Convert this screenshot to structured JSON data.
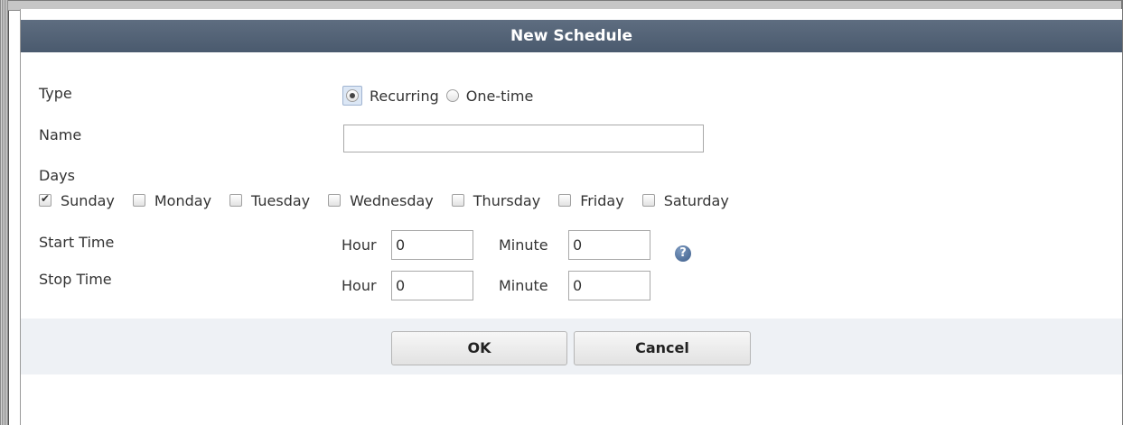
{
  "dialog": {
    "title": "New Schedule"
  },
  "form": {
    "type_label": "Type",
    "type_options": [
      {
        "label": "Recurring",
        "selected": true
      },
      {
        "label": "One-time",
        "selected": false
      }
    ],
    "name_label": "Name",
    "name_value": "",
    "days_label": "Days",
    "days": [
      {
        "label": "Sunday",
        "checked": true
      },
      {
        "label": "Monday",
        "checked": false
      },
      {
        "label": "Tuesday",
        "checked": false
      },
      {
        "label": "Wednesday",
        "checked": false
      },
      {
        "label": "Thursday",
        "checked": false
      },
      {
        "label": "Friday",
        "checked": false
      },
      {
        "label": "Saturday",
        "checked": false
      }
    ],
    "start_time_label": "Start Time",
    "stop_time_label": "Stop Time",
    "hour_label": "Hour",
    "minute_label": "Minute",
    "start_hour": "0",
    "start_minute": "0",
    "stop_hour": "0",
    "stop_minute": "0",
    "help_icon": "question-icon"
  },
  "buttons": {
    "ok_label": "OK",
    "cancel_label": "Cancel"
  },
  "colors": {
    "title_bar": "#4f5f73",
    "button_bar": "#eef1f5"
  }
}
